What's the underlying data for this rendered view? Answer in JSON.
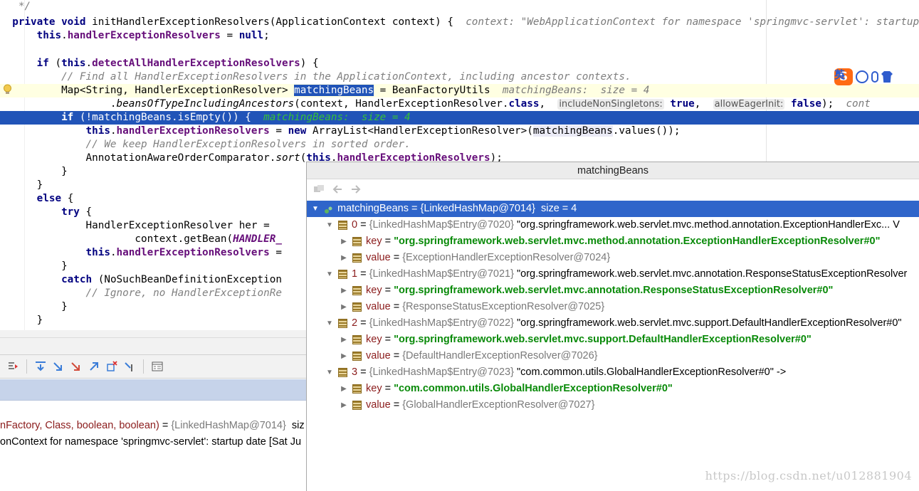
{
  "editor": {
    "lines": [
      {
        "segments": [
          {
            "t": "   */",
            "c": "cmt"
          }
        ]
      },
      {
        "segments": [
          {
            "t": "  private void ",
            "c": "kw"
          },
          {
            "t": "initHandlerExceptionResolvers(ApplicationContext context) {  "
          },
          {
            "t": "context: \"WebApplicationContext for namespace 'springmvc-servlet': startup",
            "c": "hint"
          }
        ]
      },
      {
        "segments": [
          {
            "t": "      this",
            "c": "kw"
          },
          {
            "t": "."
          },
          {
            "t": "handlerExceptionResolvers",
            "c": "fld"
          },
          {
            "t": " = "
          },
          {
            "t": "null",
            "c": "kw"
          },
          {
            "t": ";"
          }
        ]
      },
      {
        "segments": []
      },
      {
        "segments": [
          {
            "t": "      if ",
            "c": "kw"
          },
          {
            "t": "("
          },
          {
            "t": "this",
            "c": "kw"
          },
          {
            "t": "."
          },
          {
            "t": "detectAllHandlerExceptionResolvers",
            "c": "fld"
          },
          {
            "t": ") {"
          }
        ]
      },
      {
        "segments": [
          {
            "t": "          // Find all HandlerExceptionResolvers in the ApplicationContext, including ancestor contexts.",
            "c": "cmt"
          }
        ]
      },
      {
        "hl": true,
        "segments": [
          {
            "t": "          Map<String, HandlerExceptionResolver> "
          },
          {
            "t": "matchingBeans",
            "c": "selword"
          },
          {
            "t": " = BeanFactoryUtils  "
          },
          {
            "t": "matchingBeans:  size = 4",
            "c": "hint"
          }
        ]
      },
      {
        "segments": [
          {
            "t": "                  ."
          },
          {
            "t": "beansOfTypeIncludingAncestors",
            "c": "stat"
          },
          {
            "t": "(context, HandlerExceptionResolver."
          },
          {
            "t": "class",
            "c": "kw"
          },
          {
            "t": ",  "
          },
          {
            "t": "includeNonSingletons:",
            "c": "param"
          },
          {
            "t": " "
          },
          {
            "t": "true",
            "c": "kw"
          },
          {
            "t": ",  "
          },
          {
            "t": "allowEagerInit:",
            "c": "param"
          },
          {
            "t": " "
          },
          {
            "t": "false",
            "c": "kw"
          },
          {
            "t": ");  "
          },
          {
            "t": "cont",
            "c": "hint"
          }
        ]
      },
      {
        "sel": true,
        "segments": [
          {
            "t": "          if ",
            "c": "kw"
          },
          {
            "t": "(!matchingBeans.isEmpty()) {  "
          },
          {
            "t": "matchingBeans:  size = 4",
            "c": "hint-green"
          }
        ]
      },
      {
        "segments": [
          {
            "t": "              this",
            "c": "kw"
          },
          {
            "t": "."
          },
          {
            "t": "handlerExceptionResolvers",
            "c": "fld"
          },
          {
            "t": " = "
          },
          {
            "t": "new ",
            "c": "kw"
          },
          {
            "t": "ArrayList<HandlerExceptionResolver>("
          },
          {
            "t": "matchingBeans",
            "c": "usage"
          },
          {
            "t": ".values());"
          }
        ]
      },
      {
        "segments": [
          {
            "t": "              // We keep HandlerExceptionResolvers in sorted order.",
            "c": "cmt"
          }
        ]
      },
      {
        "segments": [
          {
            "t": "              AnnotationAwareOrderComparator."
          },
          {
            "t": "sort",
            "c": "stat"
          },
          {
            "t": "("
          },
          {
            "t": "this",
            "c": "kw"
          },
          {
            "t": "."
          },
          {
            "t": "handlerExceptionResolvers",
            "c": "fld"
          },
          {
            "t": ");"
          }
        ]
      },
      {
        "segments": [
          {
            "t": "          }"
          }
        ]
      },
      {
        "segments": [
          {
            "t": "      }"
          }
        ]
      },
      {
        "segments": [
          {
            "t": "      else ",
            "c": "kw"
          },
          {
            "t": "{"
          }
        ]
      },
      {
        "segments": [
          {
            "t": "          try ",
            "c": "kw"
          },
          {
            "t": "{"
          }
        ]
      },
      {
        "segments": [
          {
            "t": "              HandlerExceptionResolver her ="
          }
        ]
      },
      {
        "segments": [
          {
            "t": "                      context.getBean("
          },
          {
            "t": "HANDLER_",
            "c": "cst"
          }
        ]
      },
      {
        "segments": [
          {
            "t": "              this",
            "c": "kw"
          },
          {
            "t": "."
          },
          {
            "t": "handlerExceptionResolvers",
            "c": "fld"
          },
          {
            "t": " ="
          }
        ]
      },
      {
        "segments": [
          {
            "t": "          }"
          }
        ]
      },
      {
        "segments": [
          {
            "t": "          catch ",
            "c": "kw"
          },
          {
            "t": "(NoSuchBeanDefinitionException"
          }
        ]
      },
      {
        "segments": [
          {
            "t": "              // Ignore, no HandlerExceptionRe",
            "c": "cmt"
          }
        ]
      },
      {
        "segments": [
          {
            "t": "          }"
          }
        ]
      },
      {
        "segments": [
          {
            "t": "      }"
          }
        ]
      }
    ]
  },
  "ime": {
    "logo": "S",
    "label": "英",
    "punct": "•,"
  },
  "frames": [
    {
      "method": "nFactory, Class, boolean, boolean)",
      "eq": " = ",
      "val": "{LinkedHashMap@7014}",
      "rest": "  siz"
    },
    {
      "method": "",
      "eq": "",
      "val": "",
      "rest": "onContext for namespace 'springmvc-servlet': startup date [Sat Ju"
    }
  ],
  "popup": {
    "title": "matchingBeans",
    "rows": [
      {
        "depth": 0,
        "open": true,
        "root": true,
        "icon": "map",
        "name": "matchingBeans",
        "ref": "{LinkedHashMap@7014}",
        "tail": "  size = 4"
      },
      {
        "depth": 1,
        "open": true,
        "icon": "field",
        "name": "0",
        "ref": "{LinkedHashMap$Entry@7020}",
        "tail": " \"org.springframework.web.servlet.mvc.method.annotation.ExceptionHandlerExc... V"
      },
      {
        "depth": 2,
        "open": false,
        "icon": "field",
        "name": "key",
        "str": "\"org.springframework.web.servlet.mvc.method.annotation.ExceptionHandlerExceptionResolver#0\""
      },
      {
        "depth": 2,
        "open": false,
        "icon": "field",
        "name": "value",
        "ref": "{ExceptionHandlerExceptionResolver@7024}"
      },
      {
        "depth": 1,
        "open": true,
        "icon": "field",
        "name": "1",
        "ref": "{LinkedHashMap$Entry@7021}",
        "tail": " \"org.springframework.web.servlet.mvc.annotation.ResponseStatusExceptionResolver"
      },
      {
        "depth": 2,
        "open": false,
        "icon": "field",
        "name": "key",
        "str": "\"org.springframework.web.servlet.mvc.annotation.ResponseStatusExceptionResolver#0\""
      },
      {
        "depth": 2,
        "open": false,
        "icon": "field",
        "name": "value",
        "ref": "{ResponseStatusExceptionResolver@7025}"
      },
      {
        "depth": 1,
        "open": true,
        "icon": "field",
        "name": "2",
        "ref": "{LinkedHashMap$Entry@7022}",
        "tail": " \"org.springframework.web.servlet.mvc.support.DefaultHandlerExceptionResolver#0\""
      },
      {
        "depth": 2,
        "open": false,
        "icon": "field",
        "name": "key",
        "str": "\"org.springframework.web.servlet.mvc.support.DefaultHandlerExceptionResolver#0\""
      },
      {
        "depth": 2,
        "open": false,
        "icon": "field",
        "name": "value",
        "ref": "{DefaultHandlerExceptionResolver@7026}"
      },
      {
        "depth": 1,
        "open": true,
        "icon": "field",
        "name": "3",
        "ref": "{LinkedHashMap$Entry@7023}",
        "tail": " \"com.common.utils.GlobalHandlerExceptionResolver#0\" ->"
      },
      {
        "depth": 2,
        "open": false,
        "icon": "field",
        "name": "key",
        "str": "\"com.common.utils.GlobalHandlerExceptionResolver#0\""
      },
      {
        "depth": 2,
        "open": false,
        "icon": "field",
        "name": "value",
        "ref": "{GlobalHandlerExceptionResolver@7027}"
      }
    ]
  },
  "watermark": "https://blog.csdn.net/u012881904"
}
